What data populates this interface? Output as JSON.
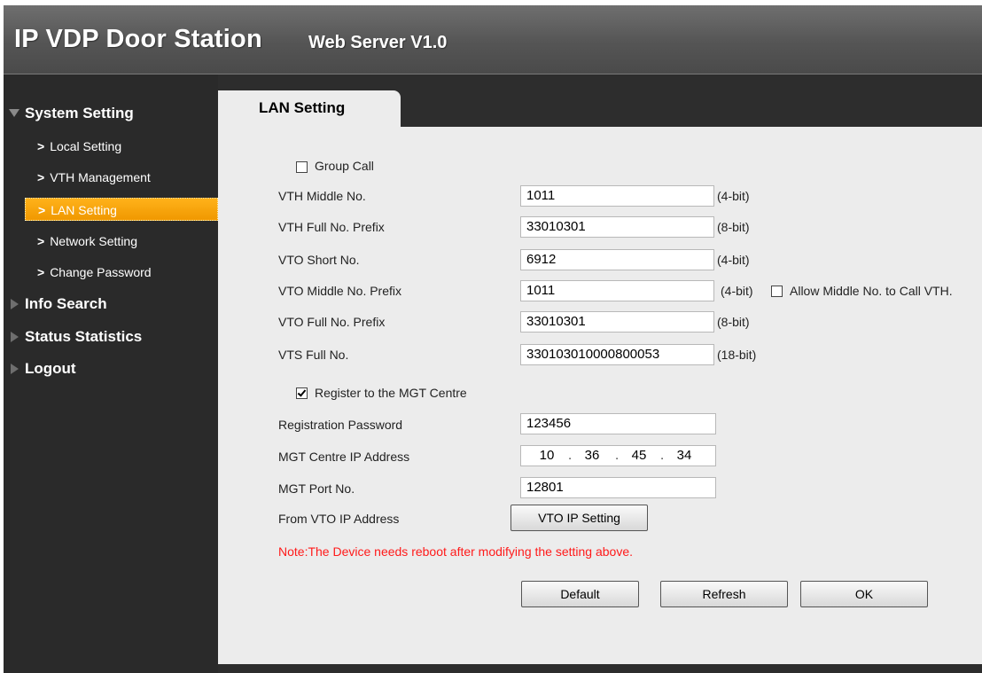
{
  "header": {
    "title": "IP VDP Door Station",
    "subtitle": "Web Server V1.0"
  },
  "sidebar": {
    "sections": [
      {
        "label": "System Setting",
        "expanded": true
      },
      {
        "label": "Info Search",
        "expanded": false
      },
      {
        "label": "Status Statistics",
        "expanded": false
      },
      {
        "label": "Logout",
        "expanded": false
      }
    ],
    "items": [
      {
        "label": "Local Setting",
        "active": false
      },
      {
        "label": "VTH Management",
        "active": false
      },
      {
        "label": "LAN Setting",
        "active": true
      },
      {
        "label": "Network Setting",
        "active": false
      },
      {
        "label": "Change Password",
        "active": false
      }
    ],
    "chevron": ">"
  },
  "tab": {
    "label": "LAN Setting"
  },
  "form": {
    "group_call": {
      "label": "Group Call",
      "checked": false
    },
    "fields": [
      {
        "label": "VTH Middle No.",
        "value": "1011",
        "hint": "(4-bit)"
      },
      {
        "label": "VTH Full No. Prefix",
        "value": "33010301",
        "hint": "(8-bit)"
      },
      {
        "label": "VTO Short No.",
        "value": "6912",
        "hint": "(4-bit)"
      },
      {
        "label": "VTO Middle No. Prefix",
        "value": "1011",
        "hint": "(4-bit)"
      },
      {
        "label": "VTO Full No. Prefix",
        "value": "33010301",
        "hint": "(8-bit)"
      },
      {
        "label": "VTS Full No.",
        "value": "330103010000800053",
        "hint": "(18-bit)"
      }
    ],
    "allow_middle": {
      "label": "Allow Middle No. to Call VTH.",
      "checked": false
    },
    "register": {
      "label": "Register to the MGT Centre",
      "checked": true
    },
    "registration_password": {
      "label": "Registration Password",
      "value": "123456"
    },
    "mgt_ip": {
      "label": "MGT Centre IP Address",
      "octets": [
        "10",
        "36",
        "45",
        "34"
      ],
      "dot": "."
    },
    "mgt_port": {
      "label": "MGT Port No.",
      "value": "12801"
    },
    "from_vto": {
      "label": "From VTO IP Address",
      "button": "VTO IP Setting"
    },
    "note": "Note:The Device needs reboot after modifying the setting above."
  },
  "actions": {
    "default": "Default",
    "refresh": "Refresh",
    "ok": "OK"
  },
  "colors": {
    "accent": "#f5a10a",
    "note": "#ff1a1a",
    "content_bg": "#ececec",
    "sidebar_bg": "#2a2a2a"
  }
}
